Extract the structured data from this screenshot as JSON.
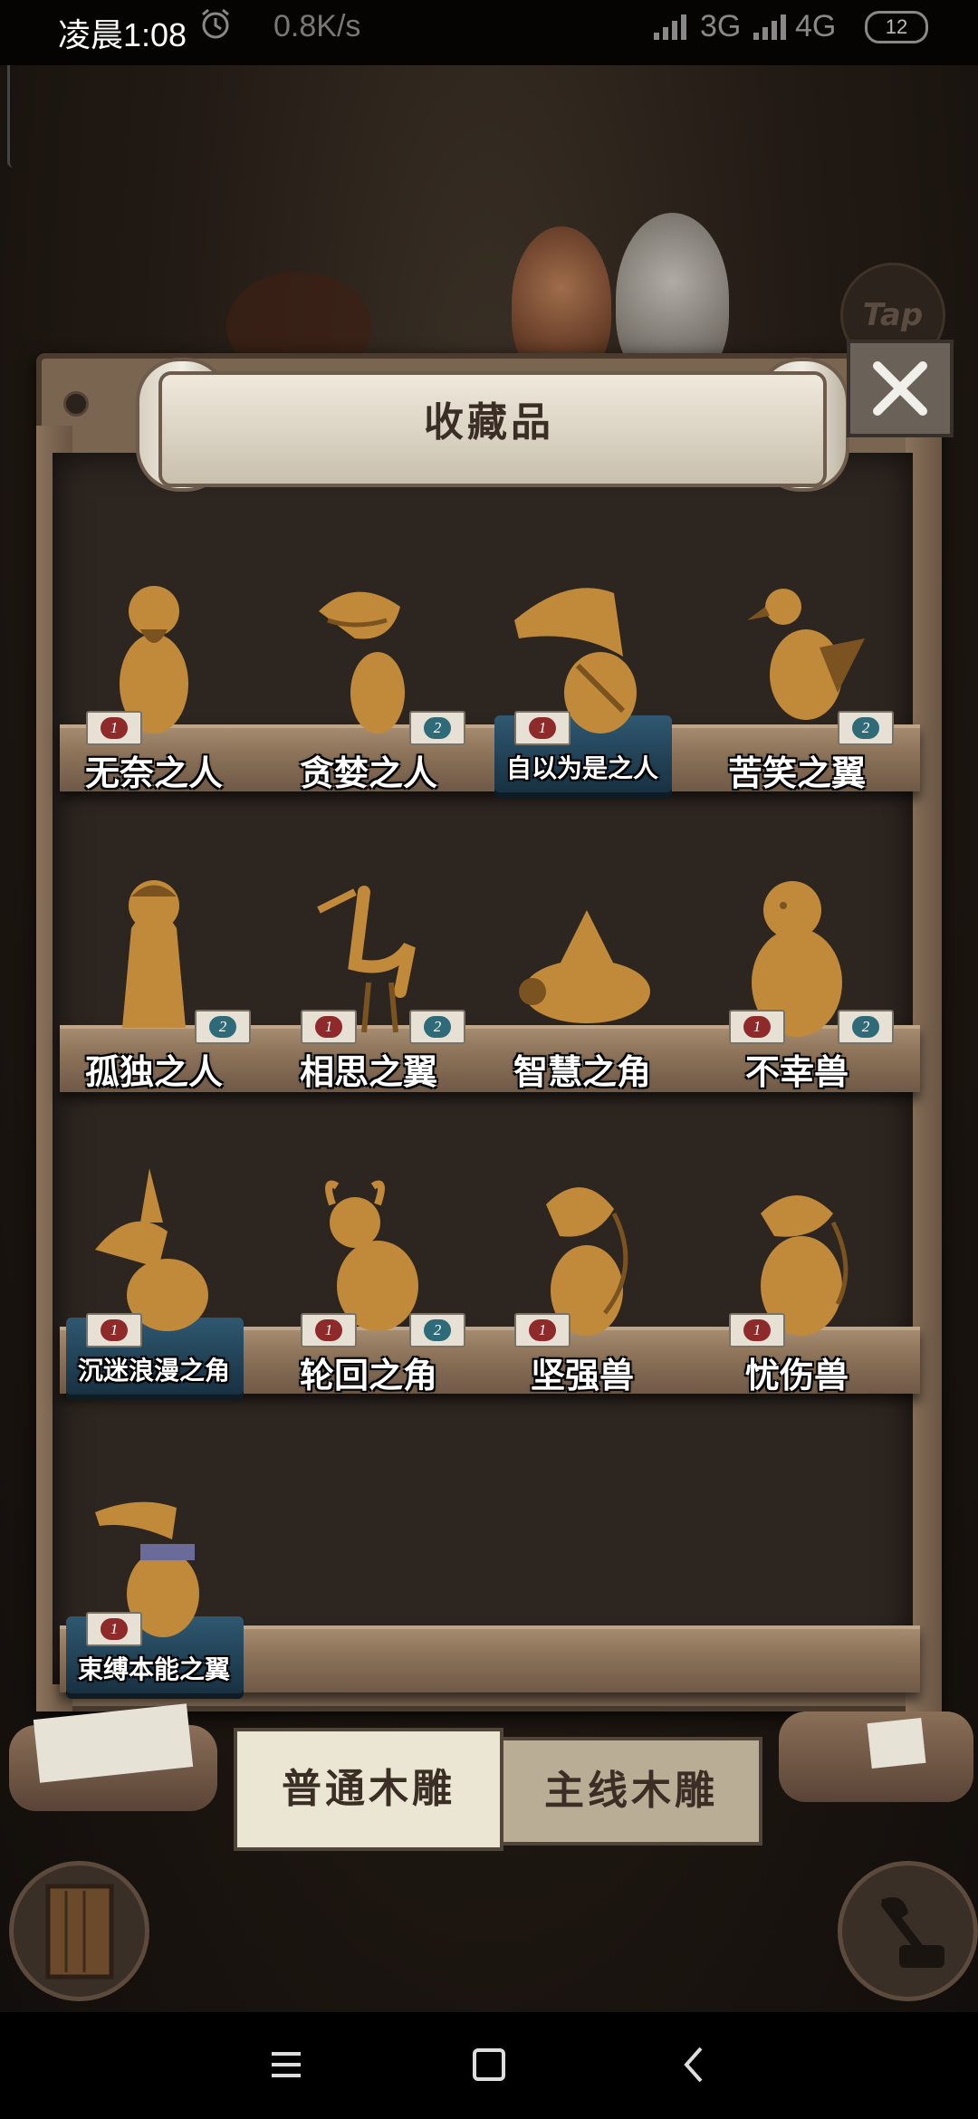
{
  "status_bar": {
    "time": "凌晨1:08",
    "speed": "0.8K/s",
    "network_1": "3G",
    "network_2": "4G",
    "battery": "12"
  },
  "header": {
    "title": "收藏品",
    "tap_hint": "Tap"
  },
  "shelves": [
    {
      "items": [
        {
          "name": "无奈之人",
          "badges": [
            "1"
          ],
          "badge_colors": [
            "red"
          ],
          "highlight": false,
          "shape": "man"
        },
        {
          "name": "贪婪之人",
          "badges": [
            "2"
          ],
          "badge_colors": [
            "teal"
          ],
          "highlight": false,
          "shape": "bigmouth"
        },
        {
          "name": "自以为是之人",
          "badges": [
            "1"
          ],
          "badge_colors": [
            "red"
          ],
          "highlight": true,
          "shape": "longnose"
        },
        {
          "name": "苦笑之翼",
          "badges": [
            "2"
          ],
          "badge_colors": [
            "teal"
          ],
          "highlight": false,
          "shape": "bird"
        }
      ]
    },
    {
      "items": [
        {
          "name": "孤独之人",
          "badges": [
            "2"
          ],
          "badge_colors": [
            "teal"
          ],
          "highlight": false,
          "shape": "girl"
        },
        {
          "name": "相思之翼",
          "badges": [
            "1",
            "2"
          ],
          "badge_colors": [
            "red",
            "teal"
          ],
          "highlight": false,
          "shape": "heron"
        },
        {
          "name": "智慧之角",
          "badges": [],
          "badge_colors": [],
          "highlight": false,
          "shape": "turtle"
        },
        {
          "name": "不幸兽",
          "badges": [
            "1",
            "2"
          ],
          "badge_colors": [
            "red",
            "teal"
          ],
          "highlight": false,
          "shape": "seal"
        }
      ]
    },
    {
      "items": [
        {
          "name": "沉迷浪漫之角",
          "badges": [
            "1"
          ],
          "badge_colors": [
            "red"
          ],
          "highlight": true,
          "shape": "dog"
        },
        {
          "name": "轮回之角",
          "badges": [
            "1",
            "2"
          ],
          "badge_colors": [
            "red",
            "teal"
          ],
          "highlight": false,
          "shape": "bull"
        },
        {
          "name": "坚强兽",
          "badges": [
            "1"
          ],
          "badge_colors": [
            "red"
          ],
          "highlight": false,
          "shape": "beast"
        },
        {
          "name": "忧伤兽",
          "badges": [
            "1"
          ],
          "badge_colors": [
            "red"
          ],
          "highlight": false,
          "shape": "sadbeast"
        }
      ]
    },
    {
      "items": [
        {
          "name": "束缚本能之翼",
          "badges": [
            "1"
          ],
          "badge_colors": [
            "red"
          ],
          "highlight": true,
          "shape": "pelican"
        }
      ]
    }
  ],
  "tabs": [
    {
      "label": "普通木雕",
      "active": true
    },
    {
      "label": "主线木雕",
      "active": false
    }
  ],
  "colors": {
    "wood": "#c08a3a",
    "wood_dark": "#7a5320",
    "badge_red": "#8e2a2a",
    "badge_teal": "#2e6a78",
    "highlight": "#2f5870"
  }
}
